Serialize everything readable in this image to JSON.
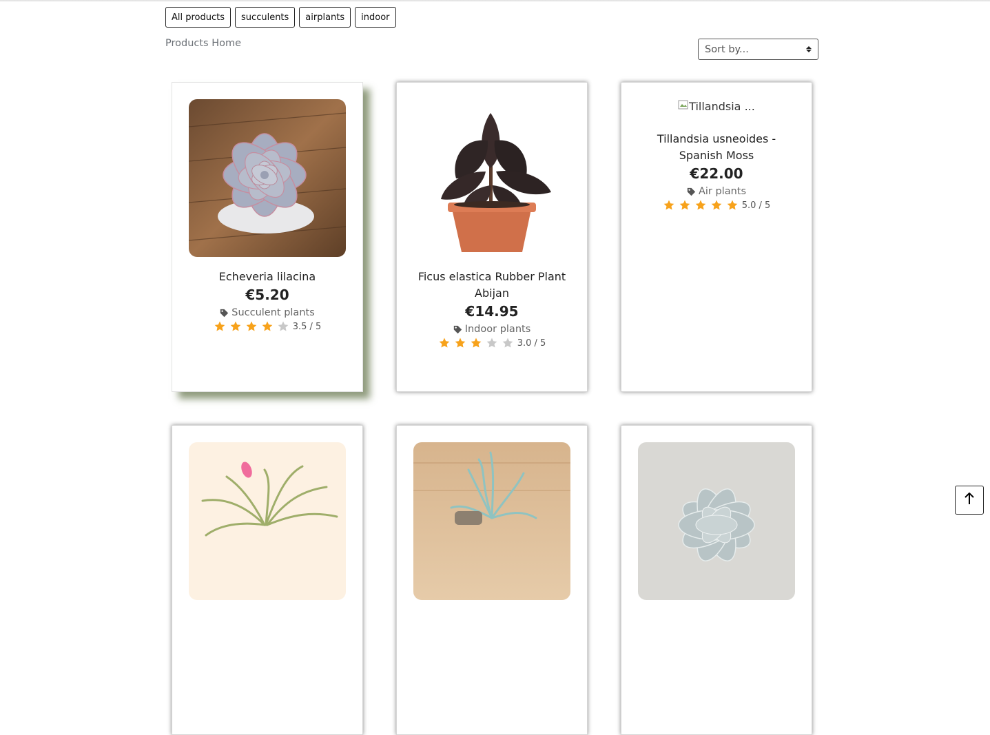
{
  "filters": [
    {
      "label": "All products"
    },
    {
      "label": "succulents"
    },
    {
      "label": "airplants"
    },
    {
      "label": "indoor"
    }
  ],
  "breadcrumb": "Products Home",
  "sort": {
    "selected": "Sort by..."
  },
  "accent_star_color": "#f7a21b",
  "products": [
    {
      "name": "Echeveria lilacina",
      "price": "€5.20",
      "category": "Succulent plants",
      "rating": 3.5,
      "rating_text": "3.5 / 5"
    },
    {
      "name": "Ficus elastica Rubber Plant Abijan",
      "price": "€14.95",
      "category": "Indoor plants",
      "rating": 3.0,
      "rating_text": "3.0 / 5"
    },
    {
      "name": "Tillandsia usneoides - Spanish Moss",
      "price": "€22.00",
      "category": "Air plants",
      "rating": 5.0,
      "rating_text": "5.0 / 5",
      "image_alt": "Tillandsia ..."
    }
  ]
}
